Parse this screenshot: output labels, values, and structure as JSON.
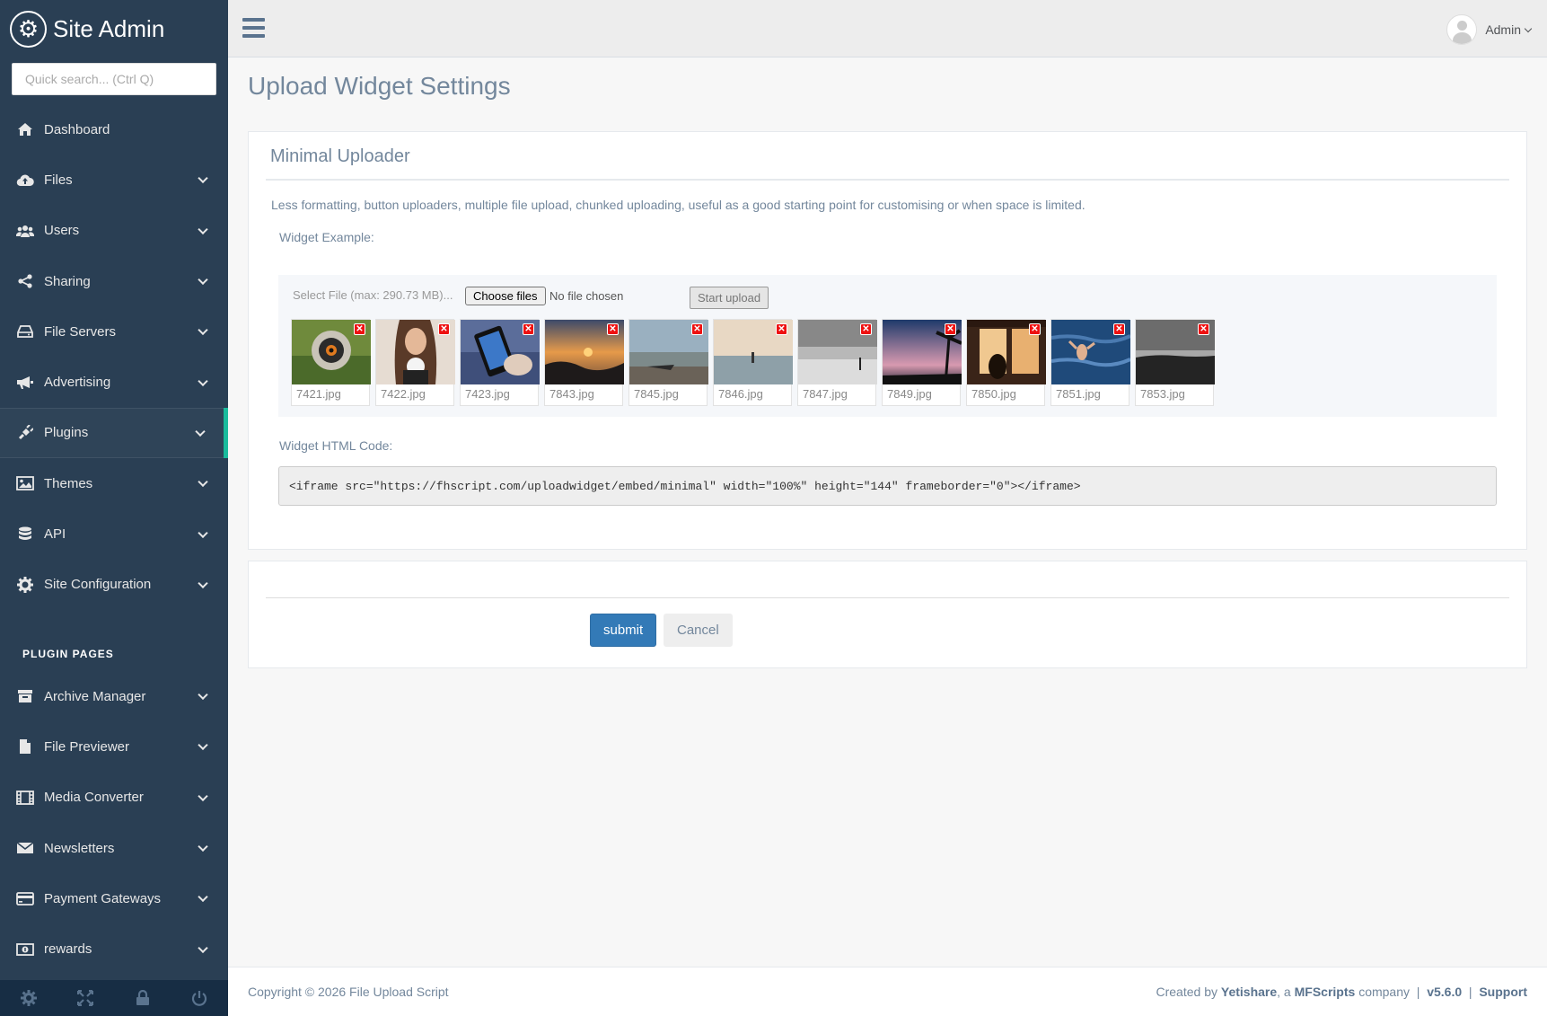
{
  "brand": {
    "name": "Site Admin"
  },
  "search": {
    "placeholder": "Quick search... (Ctrl Q)"
  },
  "sidebar": {
    "items": [
      {
        "label": "Dashboard",
        "icon": "home-icon"
      },
      {
        "label": "Files",
        "icon": "cloud-upload-icon"
      },
      {
        "label": "Users",
        "icon": "users-icon"
      },
      {
        "label": "Sharing",
        "icon": "share-icon"
      },
      {
        "label": "File Servers",
        "icon": "hdd-icon"
      },
      {
        "label": "Advertising",
        "icon": "bullhorn-icon"
      },
      {
        "label": "Plugins",
        "icon": "plug-icon"
      },
      {
        "label": "Themes",
        "icon": "image-icon"
      },
      {
        "label": "API",
        "icon": "database-icon"
      },
      {
        "label": "Site Configuration",
        "icon": "gear-icon"
      }
    ],
    "plugin_section_title": "PLUGIN PAGES",
    "plugin_items": [
      {
        "label": "Archive Manager",
        "icon": "archive-icon"
      },
      {
        "label": "File Previewer",
        "icon": "file-icon"
      },
      {
        "label": "Media Converter",
        "icon": "film-icon"
      },
      {
        "label": "Newsletters",
        "icon": "envelope-icon"
      },
      {
        "label": "Payment Gateways",
        "icon": "credit-card-icon"
      },
      {
        "label": "rewards",
        "icon": "money-icon"
      }
    ],
    "active_item": "Plugins"
  },
  "topbar": {
    "user_name": "Admin"
  },
  "page": {
    "title": "Upload Widget Settings",
    "panel_heading": "Minimal Uploader",
    "description": "Less formatting, button uploaders, multiple file upload, chunked uploading, useful as a good starting point for customising or when space is limited.",
    "widget_example_label": "Widget Example:",
    "select_file_label": "Select File (max: 290.73 MB)...",
    "choose_files_label": "Choose files",
    "no_file_chosen": "No file chosen",
    "start_upload_label": "Start upload",
    "files": [
      "7421.jpg",
      "7422.jpg",
      "7423.jpg",
      "7843.jpg",
      "7845.jpg",
      "7846.jpg",
      "7847.jpg",
      "7849.jpg",
      "7850.jpg",
      "7851.jpg",
      "7853.jpg"
    ],
    "widget_code_label": "Widget HTML Code:",
    "widget_code": "<iframe src=\"https://fhscript.com/uploadwidget/embed/minimal\" width=\"100%\" height=\"144\" frameborder=\"0\"></iframe>",
    "submit_label": "submit",
    "cancel_label": "Cancel"
  },
  "footer": {
    "copyright": "Copyright © 2026 File Upload Script",
    "created_by": "Created by",
    "vendor": "Yetishare",
    "company_prefix": ", a",
    "company": "MFScripts",
    "company_suffix": "company",
    "version": "v5.6.0",
    "support": "Support"
  },
  "colors": {
    "sidebar_bg": "#2a3f54",
    "accent": "#1abb9c",
    "primary_button": "#337ab7"
  }
}
